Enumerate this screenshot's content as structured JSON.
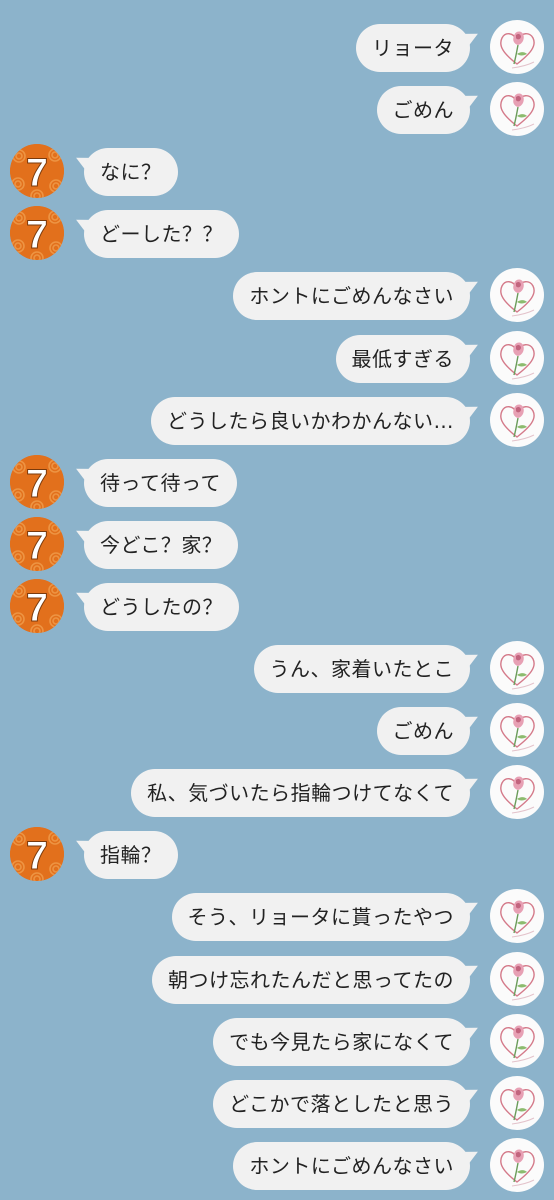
{
  "colors": {
    "background": "#8cb3cb",
    "bubble": "#f1f1f1",
    "avatar_them_bg": "#e2701c",
    "avatar_me_bg": "#fbfbfb"
  },
  "contacts": {
    "me": {
      "avatar_icon": "rose-heart-icon"
    },
    "them": {
      "avatar_icon": "number-seven-icon",
      "avatar_text": "7"
    }
  },
  "messages": [
    {
      "sender": "me",
      "text": "リョータ"
    },
    {
      "sender": "me",
      "text": "ごめん"
    },
    {
      "sender": "them",
      "text": "なに？"
    },
    {
      "sender": "them",
      "text": "どーした？？"
    },
    {
      "sender": "me",
      "text": "ホントにごめんなさい"
    },
    {
      "sender": "me",
      "text": "最低すぎる"
    },
    {
      "sender": "me",
      "text": "どうしたら良いかわかんない…"
    },
    {
      "sender": "them",
      "text": "待って待って"
    },
    {
      "sender": "them",
      "text": "今どこ？家？"
    },
    {
      "sender": "them",
      "text": "どうしたの？"
    },
    {
      "sender": "me",
      "text": "うん、家着いたとこ"
    },
    {
      "sender": "me",
      "text": "ごめん"
    },
    {
      "sender": "me",
      "text": "私、気づいたら指輪つけてなくて"
    },
    {
      "sender": "them",
      "text": "指輪？"
    },
    {
      "sender": "me",
      "text": "そう、リョータに貰ったやつ"
    },
    {
      "sender": "me",
      "text": "朝つけ忘れたんだと思ってたの"
    },
    {
      "sender": "me",
      "text": "でも今見たら家になくて"
    },
    {
      "sender": "me",
      "text": "どこかで落としたと思う"
    },
    {
      "sender": "me",
      "text": "ホントにごめんなさい"
    }
  ]
}
